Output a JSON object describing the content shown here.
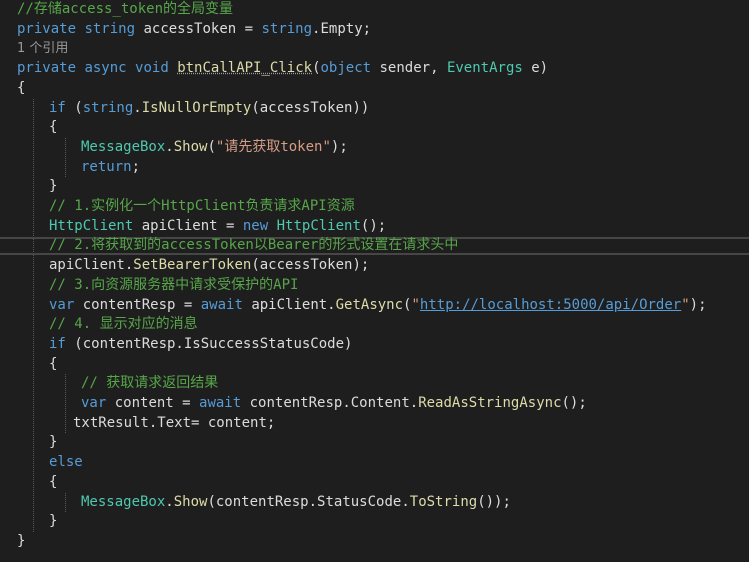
{
  "colors": {
    "background": "#1e1e1e",
    "text": "#dcdcdc",
    "keyword": "#569cd6",
    "type": "#4ec9b0",
    "method": "#dcdcaa",
    "string": "#d69d85",
    "url": "#569cd6",
    "comment": "#57a64a",
    "codelens": "#999999",
    "current_line_border": "#464646"
  },
  "lines": [
    {
      "indent": 0,
      "tokens": [
        {
          "t": "//存储access_token的全局变量",
          "k": "comment"
        }
      ]
    },
    {
      "indent": 0,
      "tokens": [
        {
          "t": "private",
          "k": "keyword"
        },
        {
          "t": " "
        },
        {
          "t": "string",
          "k": "keyword"
        },
        {
          "t": " accessToken = "
        },
        {
          "t": "string",
          "k": "keyword"
        },
        {
          "t": "."
        },
        {
          "t": "Empty",
          "k": "plain"
        },
        {
          "t": ";"
        }
      ]
    },
    {
      "indent": 0,
      "codelens": true,
      "tokens": [
        {
          "t": "1 个引用",
          "k": "codelens"
        }
      ]
    },
    {
      "indent": 0,
      "tokens": [
        {
          "t": "private",
          "k": "keyword"
        },
        {
          "t": " "
        },
        {
          "t": "async",
          "k": "keyword"
        },
        {
          "t": " "
        },
        {
          "t": "void",
          "k": "keyword"
        },
        {
          "t": " "
        },
        {
          "t": "btnCallAPI_Click",
          "k": "method"
        },
        {
          "t": "("
        },
        {
          "t": "object",
          "k": "keyword"
        },
        {
          "t": " sender, "
        },
        {
          "t": "EventArgs",
          "k": "type"
        },
        {
          "t": " e)"
        }
      ]
    },
    {
      "indent": 0,
      "tokens": [
        {
          "t": "{"
        }
      ]
    },
    {
      "indent": 1,
      "tokens": [
        {
          "t": "if",
          "k": "keyword"
        },
        {
          "t": " ("
        },
        {
          "t": "string",
          "k": "keyword"
        },
        {
          "t": "."
        },
        {
          "t": "IsNullOrEmpty",
          "k": "method"
        },
        {
          "t": "(accessToken))"
        }
      ]
    },
    {
      "indent": 1,
      "tokens": [
        {
          "t": "{"
        }
      ]
    },
    {
      "indent": 2,
      "tokens": [
        {
          "t": "MessageBox",
          "k": "type"
        },
        {
          "t": "."
        },
        {
          "t": "Show",
          "k": "method"
        },
        {
          "t": "("
        },
        {
          "t": "\"请先获取token\"",
          "k": "string"
        },
        {
          "t": ");"
        }
      ]
    },
    {
      "indent": 2,
      "tokens": [
        {
          "t": "return",
          "k": "keyword"
        },
        {
          "t": ";"
        }
      ]
    },
    {
      "indent": 1,
      "tokens": [
        {
          "t": "}"
        }
      ]
    },
    {
      "indent": 1,
      "tokens": [
        {
          "t": "// 1.实例化一个HttpClient负责请求API资源",
          "k": "comment"
        }
      ]
    },
    {
      "indent": 1,
      "tokens": [
        {
          "t": "HttpClient",
          "k": "type"
        },
        {
          "t": " apiClient = "
        },
        {
          "t": "new",
          "k": "keyword"
        },
        {
          "t": " "
        },
        {
          "t": "HttpClient",
          "k": "type"
        },
        {
          "t": "();"
        }
      ]
    },
    {
      "indent": 1,
      "current": true,
      "tokens": [
        {
          "t": "// 2.将获取到的accessToken以Bearer的形式设置在请求头中",
          "k": "comment"
        }
      ]
    },
    {
      "indent": 1,
      "tokens": [
        {
          "t": "apiClient."
        },
        {
          "t": "SetBearerToken",
          "k": "method"
        },
        {
          "t": "(accessToken);"
        }
      ]
    },
    {
      "indent": 1,
      "tokens": [
        {
          "t": "// 3.向资源服务器中请求受保护的API",
          "k": "comment"
        }
      ]
    },
    {
      "indent": 1,
      "tokens": [
        {
          "t": "var",
          "k": "keyword"
        },
        {
          "t": " contentResp = "
        },
        {
          "t": "await",
          "k": "keyword"
        },
        {
          "t": " apiClient."
        },
        {
          "t": "GetAsync",
          "k": "method"
        },
        {
          "t": "("
        },
        {
          "t": "\"",
          "k": "string"
        },
        {
          "t": "http://localhost:5000/api/Order",
          "k": "url"
        },
        {
          "t": "\"",
          "k": "string"
        },
        {
          "t": ");"
        }
      ]
    },
    {
      "indent": 1,
      "tokens": [
        {
          "t": "// 4. 显示对应的消息",
          "k": "comment"
        }
      ]
    },
    {
      "indent": 1,
      "tokens": [
        {
          "t": "if",
          "k": "keyword"
        },
        {
          "t": " (contentResp."
        },
        {
          "t": "IsSuccessStatusCode",
          "k": "plain"
        },
        {
          "t": ")"
        }
      ]
    },
    {
      "indent": 1,
      "tokens": [
        {
          "t": "{"
        }
      ]
    },
    {
      "indent": 2,
      "tokens": [
        {
          "t": "// 获取请求返回结果",
          "k": "comment"
        }
      ]
    },
    {
      "indent": 2,
      "tokens": [
        {
          "t": "var",
          "k": "keyword"
        },
        {
          "t": " content = "
        },
        {
          "t": "await",
          "k": "keyword"
        },
        {
          "t": " contentResp."
        },
        {
          "t": "Content",
          "k": "plain"
        },
        {
          "t": "."
        },
        {
          "t": "ReadAsStringAsync",
          "k": "method"
        },
        {
          "t": "();"
        }
      ]
    },
    {
      "indent": 1,
      "extra": 3,
      "tokens": [
        {
          "t": "txtResult."
        },
        {
          "t": "Text",
          "k": "plain"
        },
        {
          "t": "= content;"
        }
      ]
    },
    {
      "indent": 1,
      "tokens": [
        {
          "t": "}"
        }
      ]
    },
    {
      "indent": 1,
      "tokens": [
        {
          "t": "else",
          "k": "keyword"
        }
      ]
    },
    {
      "indent": 1,
      "tokens": [
        {
          "t": "{"
        }
      ]
    },
    {
      "indent": 2,
      "tokens": [
        {
          "t": "MessageBox",
          "k": "type"
        },
        {
          "t": "."
        },
        {
          "t": "Show",
          "k": "method"
        },
        {
          "t": "(contentResp."
        },
        {
          "t": "StatusCode",
          "k": "plain"
        },
        {
          "t": "."
        },
        {
          "t": "ToString",
          "k": "method"
        },
        {
          "t": "());"
        }
      ]
    },
    {
      "indent": 1,
      "tokens": [
        {
          "t": "}"
        }
      ]
    },
    {
      "indent": 0,
      "tokens": [
        {
          "t": "}"
        }
      ]
    }
  ]
}
